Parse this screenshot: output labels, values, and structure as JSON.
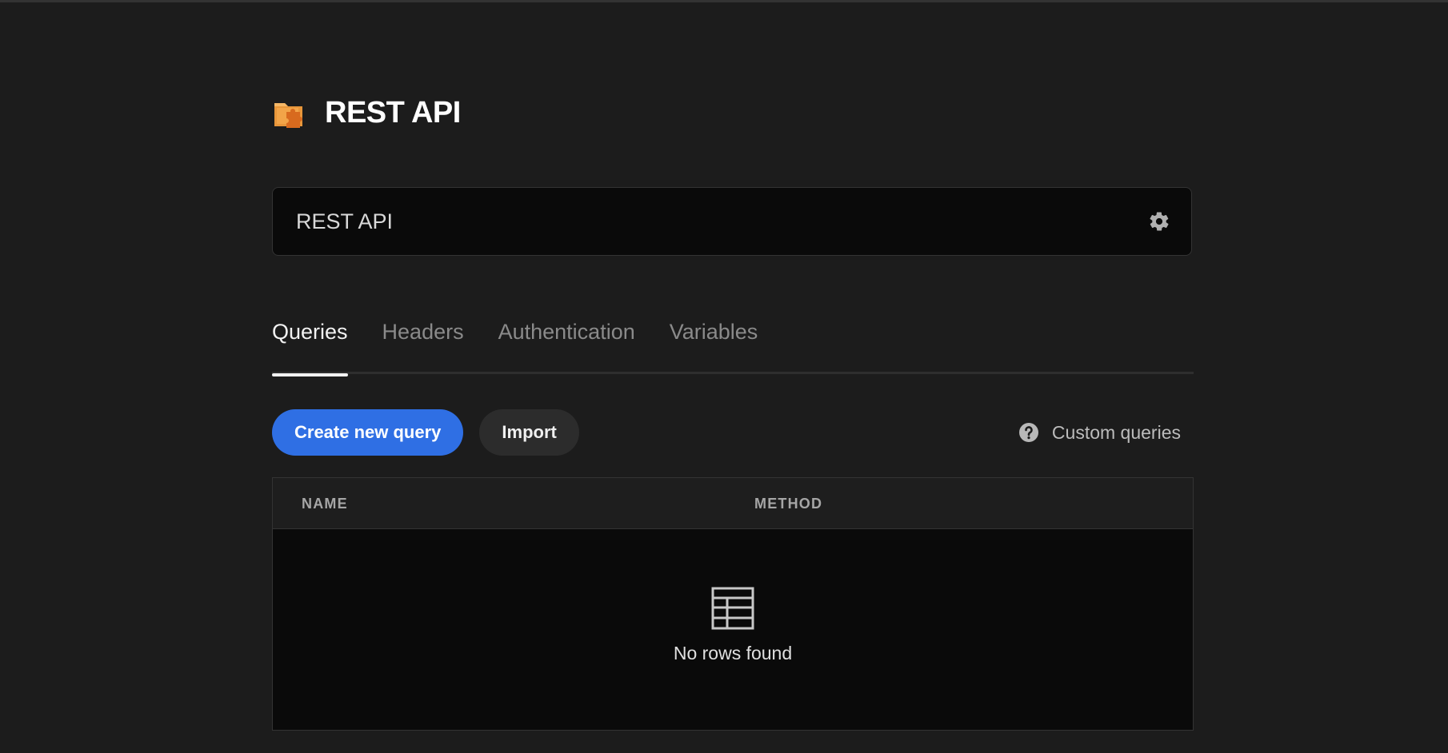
{
  "header": {
    "title": "REST API",
    "icon": "puzzle-folder-icon"
  },
  "datasource": {
    "name_value": "REST API",
    "settings_icon": "gear-icon"
  },
  "tabs": [
    {
      "label": "Queries",
      "active": true
    },
    {
      "label": "Headers",
      "active": false
    },
    {
      "label": "Authentication",
      "active": false
    },
    {
      "label": "Variables",
      "active": false
    }
  ],
  "actions": {
    "create_label": "Create new query",
    "import_label": "Import",
    "help_label": "Custom queries",
    "help_icon": "question-circle-icon"
  },
  "table": {
    "columns": [
      "NAME",
      "METHOD"
    ],
    "rows": [],
    "empty_text": "No rows found",
    "empty_icon": "table-icon"
  },
  "colors": {
    "background": "#1c1c1c",
    "accent": "#2f6fe4",
    "icon_orange": "#f0a34a"
  }
}
